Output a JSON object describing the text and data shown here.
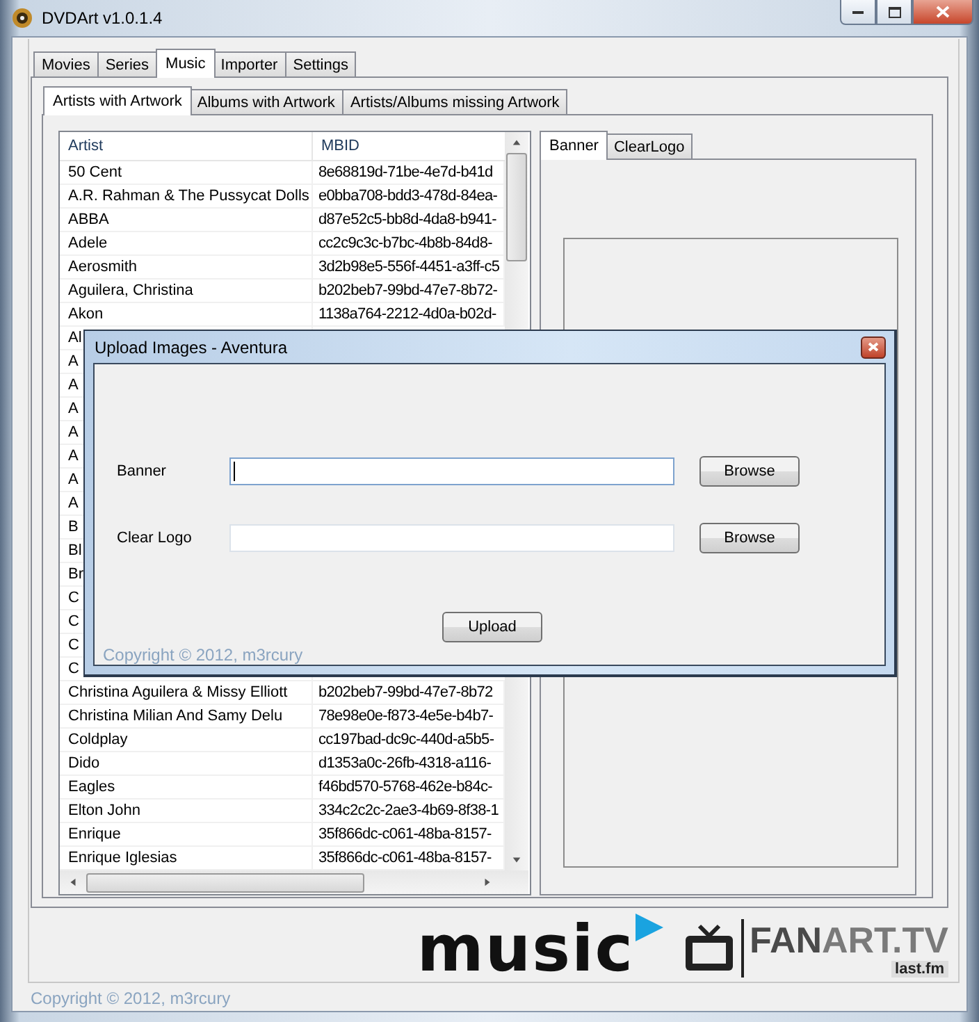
{
  "window": {
    "title": "DVDArt v1.0.1.4"
  },
  "tabs": [
    {
      "label": "Movies",
      "selected": false
    },
    {
      "label": "Series",
      "selected": false
    },
    {
      "label": "Music",
      "selected": true
    },
    {
      "label": "Importer",
      "selected": false
    },
    {
      "label": "Settings",
      "selected": false
    }
  ],
  "sub_tabs": [
    {
      "label": "Artists with Artwork",
      "selected": true
    },
    {
      "label": "Albums with Artwork",
      "selected": false
    },
    {
      "label": "Artists/Albums missing Artwork",
      "selected": false
    }
  ],
  "artist_table": {
    "columns": [
      "Artist",
      "MBID"
    ],
    "rows": [
      {
        "artist": "50 Cent",
        "mbid": "8e68819d-71be-4e7d-b41d"
      },
      {
        "artist": "A.R. Rahman & The Pussycat Dolls",
        "mbid": "e0bba708-bdd3-478d-84ea-"
      },
      {
        "artist": "ABBA",
        "mbid": "d87e52c5-bb8d-4da8-b941-"
      },
      {
        "artist": "Adele",
        "mbid": "cc2c9c3c-b7bc-4b8b-84d8-"
      },
      {
        "artist": "Aerosmith",
        "mbid": "3d2b98e5-556f-4451-a3ff-c5"
      },
      {
        "artist": "Aguilera, Christina",
        "mbid": "b202beb7-99bd-47e7-8b72-"
      },
      {
        "artist": "Akon",
        "mbid": "1138a764-2212-4d0a-b02d-"
      },
      {
        "artist": "Al"
      },
      {
        "artist": "A"
      },
      {
        "artist": "A"
      },
      {
        "artist": "A"
      },
      {
        "artist": "A"
      },
      {
        "artist": "A"
      },
      {
        "artist": "A"
      },
      {
        "artist": "A"
      },
      {
        "artist": "B"
      },
      {
        "artist": "Bl"
      },
      {
        "artist": "Br"
      },
      {
        "artist": "C"
      },
      {
        "artist": "C"
      },
      {
        "artist": "C"
      },
      {
        "artist": "C"
      },
      {
        "artist": "Christina Aguilera & Missy Elliott",
        "mbid": "b202beb7-99bd-47e7-8b72"
      },
      {
        "artist": "Christina Milian And Samy Delu",
        "mbid": "78e98e0e-f873-4e5e-b4b7-"
      },
      {
        "artist": "Coldplay",
        "mbid": "cc197bad-dc9c-440d-a5b5-"
      },
      {
        "artist": "Dido",
        "mbid": "d1353a0c-26fb-4318-a116-"
      },
      {
        "artist": "Eagles",
        "mbid": "f46bd570-5768-462e-b84c-"
      },
      {
        "artist": "Elton John",
        "mbid": "334c2c2c-2ae3-4b69-8f38-1"
      },
      {
        "artist": "Enrique",
        "mbid": "35f866dc-c061-48ba-8157-"
      },
      {
        "artist": "Enrique Iglesias",
        "mbid": "35f866dc-c061-48ba-8157-"
      }
    ]
  },
  "preview_tabs": [
    {
      "label": "Banner",
      "selected": true
    },
    {
      "label": "ClearLogo",
      "selected": false
    }
  ],
  "logos": {
    "music": "music",
    "fanart": [
      "FAN",
      "ART.TV"
    ],
    "lastfm": "last.fm"
  },
  "copyright": "Copyright © 2012, m3rcury",
  "dialog": {
    "title": "Upload Images - Aventura",
    "fields": [
      {
        "label": "Banner",
        "button": "Browse",
        "focused": true
      },
      {
        "label": "Clear Logo",
        "button": "Browse",
        "focused": false
      }
    ],
    "submit": "Upload",
    "copyright": "Copyright © 2012, m3rcury"
  }
}
